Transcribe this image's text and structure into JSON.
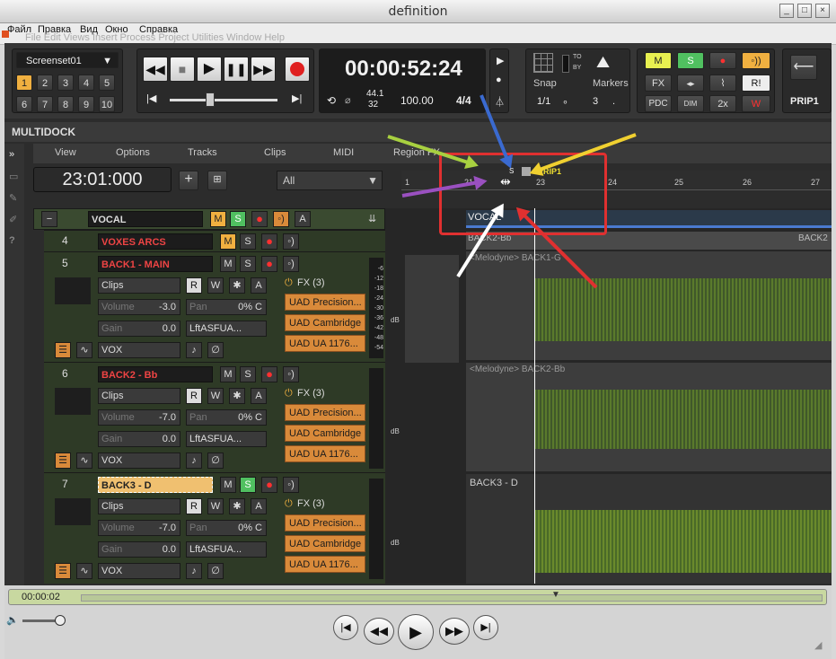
{
  "window": {
    "title": "definition"
  },
  "menu": {
    "items": [
      "Файл",
      "Правка",
      "Вид",
      "Окно",
      "Справка"
    ],
    "ghost": "File  Edit  Views  Insert  Process  Project  Utilities  Window  Help"
  },
  "screenset": {
    "label": "Screenset01",
    "numbers": [
      "1",
      "2",
      "3",
      "4",
      "5",
      "6",
      "7",
      "8",
      "9",
      "10"
    ]
  },
  "transport": {
    "time": "00:00:52:24",
    "sample_rate": "44.1",
    "bit_depth": "32",
    "tempo": "100.00",
    "meter": "4/4"
  },
  "snap": {
    "label": "Snap",
    "to": "TO",
    "by": "BY",
    "value": "1/1",
    "markers_label": "Markers",
    "markers_value": "3"
  },
  "mix": {
    "m": "M",
    "s": "S",
    "fx": "FX",
    "pdc": "PDC",
    "dim": "DIM",
    "x2": "2x",
    "r": "R!"
  },
  "prip": {
    "label": "PRIP1"
  },
  "multidock": {
    "title": "MULTIDOCK"
  },
  "trackview": {
    "menus": [
      "View",
      "Options",
      "Tracks",
      "Clips",
      "MIDI",
      "Region FX"
    ],
    "position": "23:01:000",
    "filter": "All"
  },
  "ruler": {
    "marks": [
      "1",
      "21",
      "23",
      "24",
      "25",
      "26",
      "27"
    ],
    "marker": "PRIP1",
    "s": "S"
  },
  "folder": {
    "name": "VOCAL",
    "clip": "VOCAL",
    "m": "M",
    "s": "S",
    "a": "A"
  },
  "tracks": [
    {
      "num": "4",
      "name": "VOXES ARCS",
      "m": "M",
      "s": "S"
    },
    {
      "num": "5",
      "name": "BACK1 - MAIN",
      "clip_mode": "Clips",
      "r": "R",
      "w": "W",
      "a": "A",
      "fx": "FX (3)",
      "volume_label": "Volume",
      "volume": "-3.0",
      "pan_label": "Pan",
      "pan": "0% C",
      "gain_label": "Gain",
      "gain": "0.0",
      "input": "LftASFUA...",
      "output": "VOX",
      "plugins": [
        "UAD Precision...",
        "UAD Cambridge",
        "UAD UA 1176..."
      ],
      "clip_name": "<Melodyne> BACK1-G"
    },
    {
      "num": "6",
      "name": "BACK2 - Bb",
      "clip_mode": "Clips",
      "r": "R",
      "w": "W",
      "a": "A",
      "fx": "FX (3)",
      "volume_label": "Volume",
      "volume": "-7.0",
      "pan_label": "Pan",
      "pan": "0% C",
      "gain_label": "Gain",
      "gain": "0.0",
      "input": "LftASFUA...",
      "output": "VOX",
      "plugins": [
        "UAD Precision...",
        "UAD Cambridge",
        "UAD UA 1176..."
      ],
      "clip_name": "<Melodyne> BACK2-Bb"
    },
    {
      "num": "7",
      "name": "BACK3 - D",
      "clip_mode": "Clips",
      "r": "R",
      "w": "W",
      "a": "A",
      "fx": "FX (3)",
      "volume_label": "Volume",
      "volume": "-7.0",
      "pan_label": "Pan",
      "pan": "0% C",
      "gain_label": "Gain",
      "gain": "0.0",
      "input": "LftASFUA...",
      "output": "VOX",
      "plugins": [
        "UAD Precision...",
        "UAD Cambridge",
        "UAD UA 1176..."
      ],
      "clip_name": "BACK3 - D"
    }
  ],
  "lanes": {
    "back2_top": "BACK2-Bb",
    "back2_right": "BACK2",
    "db": "dB"
  },
  "meter_scale": [
    "-6",
    "-12",
    "-18",
    "-24",
    "-30",
    "-36",
    "-42",
    "-48",
    "-54"
  ],
  "player": {
    "time": "00:00:02"
  },
  "colors": {
    "accent": "#f0b040",
    "track_name": "#ee4444",
    "annotation_box": "#e03030",
    "arrow_green": "#a8d040",
    "arrow_blue": "#3a6ad0",
    "arrow_yellow": "#f0d030",
    "arrow_purple": "#9a50c0",
    "arrow_white": "#ffffff",
    "arrow_red": "#e03030"
  }
}
